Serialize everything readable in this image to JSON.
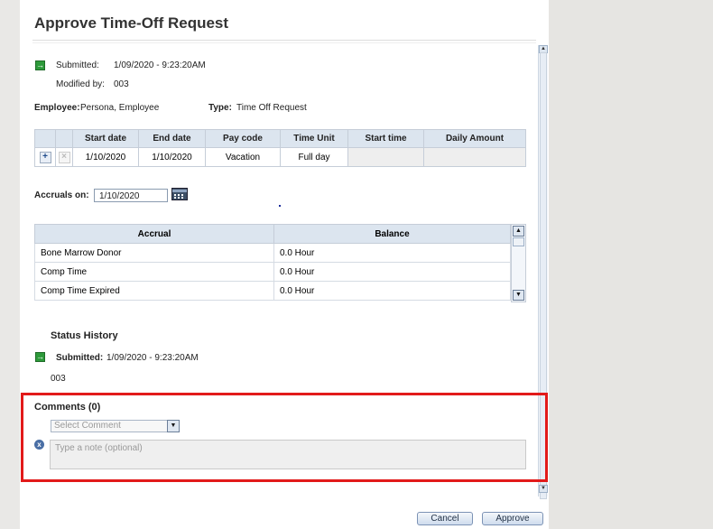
{
  "dialog": {
    "title": "Approve Time-Off Request",
    "submitted_label": "Submitted:",
    "submitted_value": "1/09/2020 - 9:23:20AM",
    "modified_label": "Modified by:",
    "modified_value": "003",
    "employee_label": "Employee:",
    "employee_value": "Persona, Employee",
    "type_label": "Type:",
    "type_value": "Time Off Request"
  },
  "request_table": {
    "headers": [
      "Start date",
      "End date",
      "Pay code",
      "Time Unit",
      "Start time",
      "Daily Amount"
    ],
    "add_icon": "+",
    "remove_icon": "×",
    "row": [
      "1/10/2020",
      "1/10/2020",
      "Vacation",
      "Full day",
      "",
      ""
    ]
  },
  "accruals": {
    "label": "Accruals on:",
    "date": "1/10/2020",
    "calendar_icon": "calendar-icon",
    "headers": [
      "Accrual",
      "Balance"
    ],
    "rows": [
      {
        "accrual": "Bone Marrow Donor",
        "balance": "0.0 Hour"
      },
      {
        "accrual": "Comp Time",
        "balance": "0.0 Hour"
      },
      {
        "accrual": "Comp Time Expired",
        "balance": "0.0 Hour"
      }
    ],
    "scroll_up": "▲",
    "scroll_down": "▼"
  },
  "status_history": {
    "title": "Status History",
    "submitted_label": "Submitted:",
    "submitted_value": "1/09/2020 - 9:23:20AM",
    "by": "003"
  },
  "comments": {
    "title": "Comments (0)",
    "select_placeholder": "Select Comment",
    "dropdown_icon": "▼",
    "clear_icon": "x",
    "note_placeholder": "Type a note (optional)"
  },
  "scrollbar": {
    "up": "▲",
    "down": "▼"
  },
  "buttons": {
    "cancel": "Cancel",
    "approve": "Approve"
  },
  "colors": {
    "highlight": "#e21a1a",
    "header_bg": "#dce5ef",
    "submitted_icon": "#2d9a3a"
  }
}
